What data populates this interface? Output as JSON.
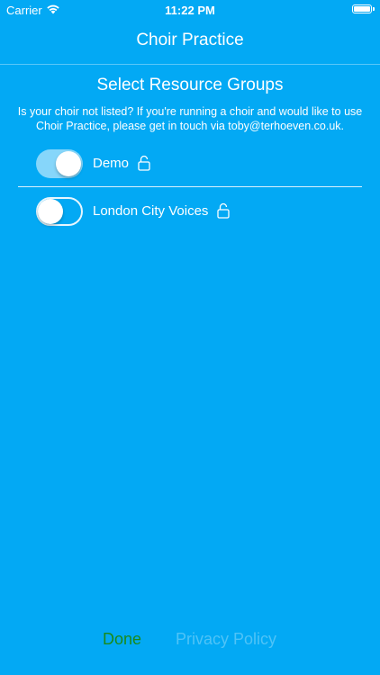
{
  "status_bar": {
    "carrier": "Carrier",
    "time": "11:22 PM",
    "battery_level": 1.0
  },
  "nav": {
    "title": "Choir Practice"
  },
  "main": {
    "section_title": "Select Resource Groups",
    "info_text": "Is your choir not listed? If you're running a choir and would like to use Choir Practice, please get in touch via toby@terhoeven.co.uk.",
    "groups": [
      {
        "label": "Demo",
        "enabled": true,
        "icon": "lock-icon"
      },
      {
        "label": "London City Voices",
        "enabled": false,
        "icon": "lock-icon"
      }
    ]
  },
  "footer": {
    "done_label": "Done",
    "privacy_label": "Privacy Policy"
  },
  "colors": {
    "background": "#03A9F4",
    "done": "#1a8a1a",
    "privacy": "#4fc3f7",
    "toggle_on": "#86D6FA"
  }
}
